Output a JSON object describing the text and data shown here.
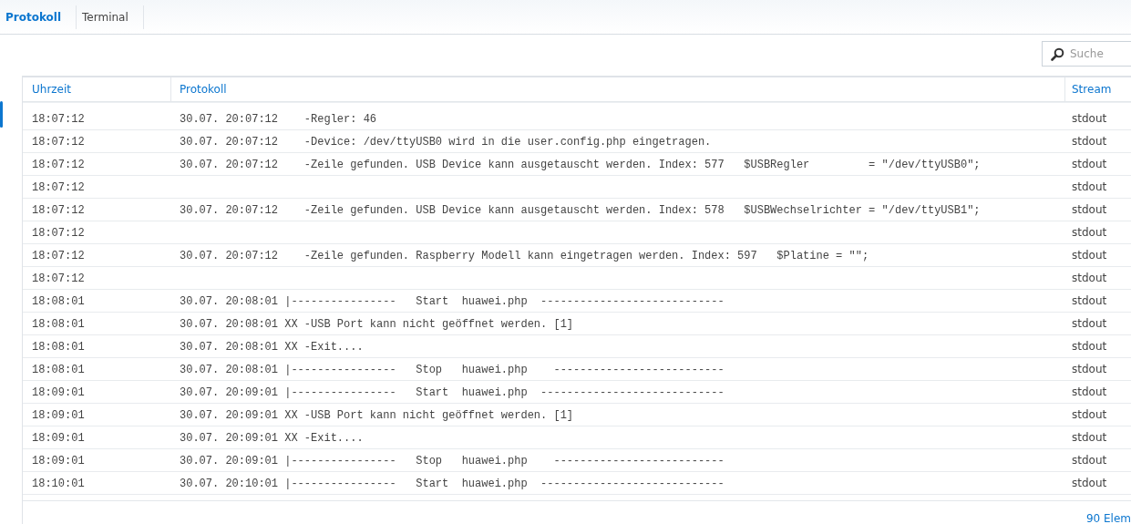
{
  "tabs": [
    {
      "label": "Protokoll",
      "selected": true
    },
    {
      "label": "Terminal",
      "selected": false
    }
  ],
  "search": {
    "placeholder": "Suche"
  },
  "table": {
    "columns": [
      "Uhrzeit",
      "Protokoll",
      "Stream"
    ],
    "rows": [
      {
        "time": "18:07:12",
        "protocol": "30.07. 20:07:12    -Regler: 46",
        "stream": "stdout"
      },
      {
        "time": "18:07:12",
        "protocol": "30.07. 20:07:12    -Device: /dev/ttyUSB0 wird in die user.config.php eingetragen.",
        "stream": "stdout"
      },
      {
        "time": "18:07:12",
        "protocol": "30.07. 20:07:12    -Zeile gefunden. USB Device kann ausgetauscht werden. Index: 577   $USBRegler         = \"/dev/ttyUSB0\";",
        "stream": "stdout"
      },
      {
        "time": "18:07:12",
        "stream": "stdout"
      },
      {
        "time": "18:07:12",
        "protocol": "30.07. 20:07:12    -Zeile gefunden. USB Device kann ausgetauscht werden. Index: 578   $USBWechselrichter = \"/dev/ttyUSB1\";",
        "stream": "stdout"
      },
      {
        "time": "18:07:12",
        "stream": "stdout"
      },
      {
        "time": "18:07:12",
        "protocol": "30.07. 20:07:12    -Zeile gefunden. Raspberry Modell kann eingetragen werden. Index: 597   $Platine = \"\";",
        "stream": "stdout"
      },
      {
        "time": "18:07:12",
        "stream": "stdout"
      },
      {
        "time": "18:08:01",
        "protocol": "30.07. 20:08:01 |----------------   Start  huawei.php  ----------------------------",
        "stream": "stdout"
      },
      {
        "time": "18:08:01",
        "protocol": "30.07. 20:08:01 XX -USB Port kann nicht geöffnet werden. [1]",
        "stream": "stdout"
      },
      {
        "time": "18:08:01",
        "protocol": "30.07. 20:08:01 XX -Exit....",
        "stream": "stdout"
      },
      {
        "time": "18:08:01",
        "protocol": "30.07. 20:08:01 |----------------   Stop   huawei.php    --------------------------",
        "stream": "stdout"
      },
      {
        "time": "18:09:01",
        "protocol": "30.07. 20:09:01 |----------------   Start  huawei.php  ----------------------------",
        "stream": "stdout"
      },
      {
        "time": "18:09:01",
        "protocol": "30.07. 20:09:01 XX -USB Port kann nicht geöffnet werden. [1]",
        "stream": "stdout"
      },
      {
        "time": "18:09:01",
        "protocol": "30.07. 20:09:01 XX -Exit....",
        "stream": "stdout"
      },
      {
        "time": "18:09:01",
        "protocol": "30.07. 20:09:01 |----------------   Stop   huawei.php    --------------------------",
        "stream": "stdout"
      },
      {
        "time": "18:10:01",
        "protocol": "30.07. 20:10:01 |----------------   Start  huawei.php  ----------------------------",
        "stream": "stdout"
      }
    ]
  },
  "footer": {
    "count": "90 Elem"
  }
}
